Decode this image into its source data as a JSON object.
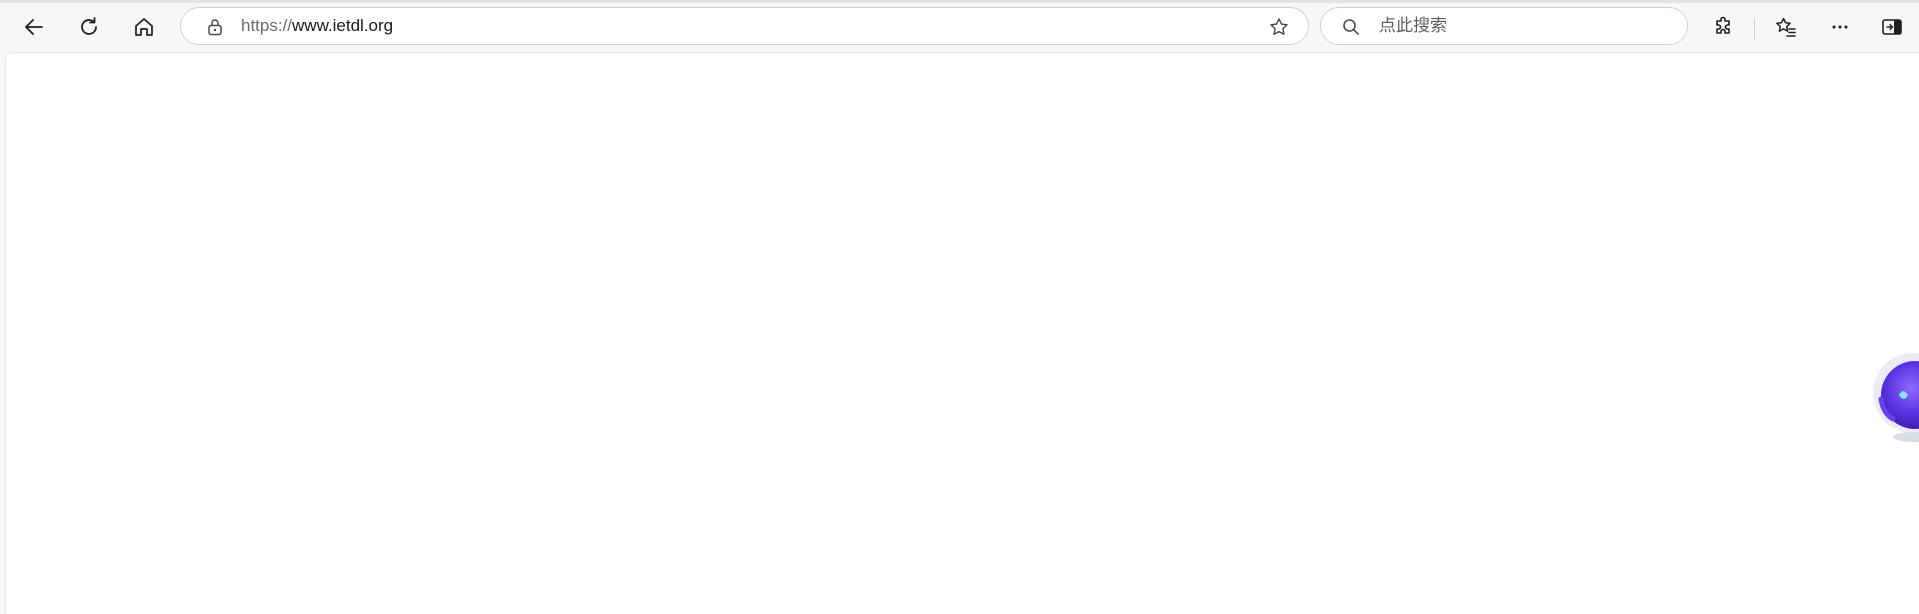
{
  "browser": {
    "address_bar": {
      "url_scheme": "https://",
      "url_host": "www.ietdl.org"
    },
    "search": {
      "placeholder": "点此搜索",
      "value": ""
    },
    "icons": {
      "back": "back-arrow-icon",
      "refresh": "refresh-icon",
      "home": "home-icon",
      "lock": "lock-icon",
      "favorite": "star-icon",
      "search": "search-icon",
      "extensions": "puzzle-icon",
      "favorites_menu": "favorites-list-icon",
      "more": "more-ellipsis-icon",
      "sidebar": "sidebar-icon"
    },
    "colors": {
      "chrome_bg": "#f7f7f7",
      "page_bg": "#ffffff",
      "assistant_accent": "#6b3df0"
    }
  },
  "page": {
    "floating_widget": "assistant-avatar-icon"
  }
}
